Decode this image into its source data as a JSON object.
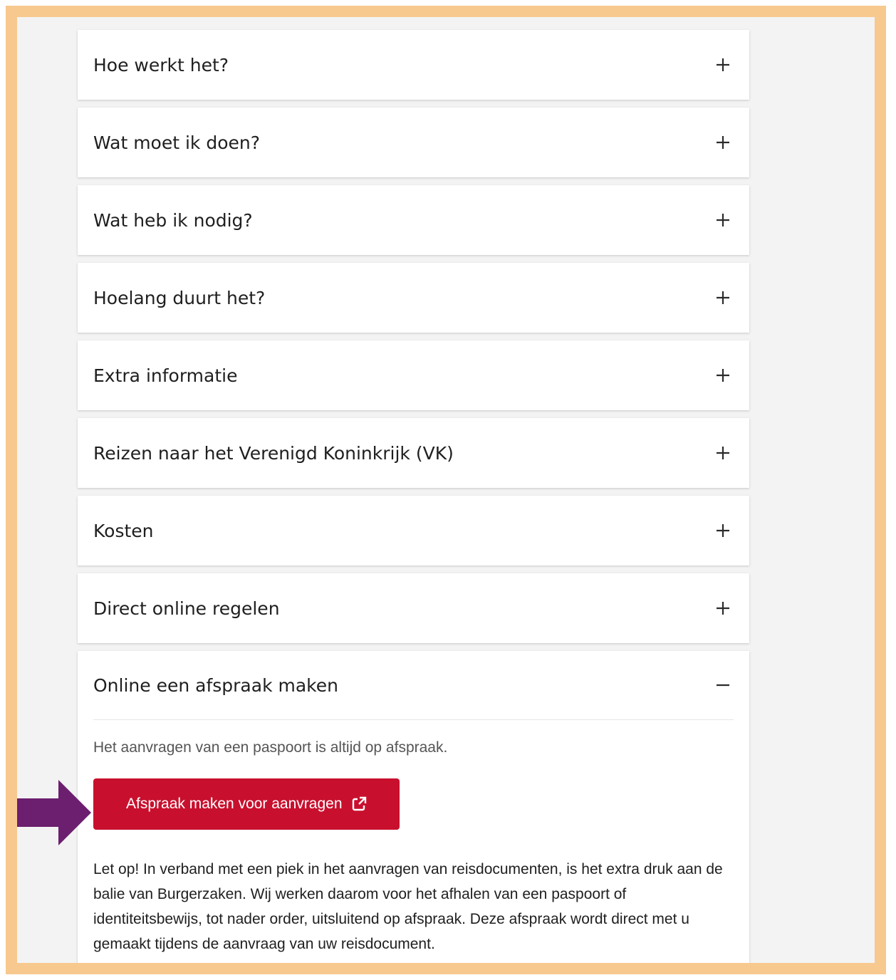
{
  "accordion": {
    "items": [
      {
        "title": "Hoe werkt het?",
        "toggle": "+"
      },
      {
        "title": "Wat moet ik doen?",
        "toggle": "+"
      },
      {
        "title": "Wat heb ik nodig?",
        "toggle": "+"
      },
      {
        "title": "Hoelang duurt het?",
        "toggle": "+"
      },
      {
        "title": "Extra informatie",
        "toggle": "+"
      },
      {
        "title": "Reizen naar het Verenigd Koninkrijk (VK)",
        "toggle": "+"
      },
      {
        "title": "Kosten",
        "toggle": "+"
      },
      {
        "title": "Direct online regelen",
        "toggle": "+"
      }
    ],
    "expanded": {
      "title": "Online een afspraak maken",
      "toggle": "−",
      "intro": "Het aanvragen van een paspoort is altijd op afspraak.",
      "button_label": "Afspraak maken voor aanvragen",
      "button_icon": "external-link-icon",
      "note": "Let op! In verband met een piek in het aanvragen van reisdocumenten, is het extra druk aan de balie van Burgerzaken. Wij werken daarom voor het afhalen van een paspoort of identiteitsbewijs, tot nader order, uitsluitend op afspraak. Deze afspraak wordt direct met u gemaakt tijdens de aanvraag van uw reisdocument."
    }
  },
  "colors": {
    "frame_border": "#f7c98f",
    "background": "#f3f3f3",
    "button": "#c8102e",
    "annotation_arrow": "#6b1f6e"
  },
  "annotation": {
    "icon": "pointer-arrow-icon"
  }
}
